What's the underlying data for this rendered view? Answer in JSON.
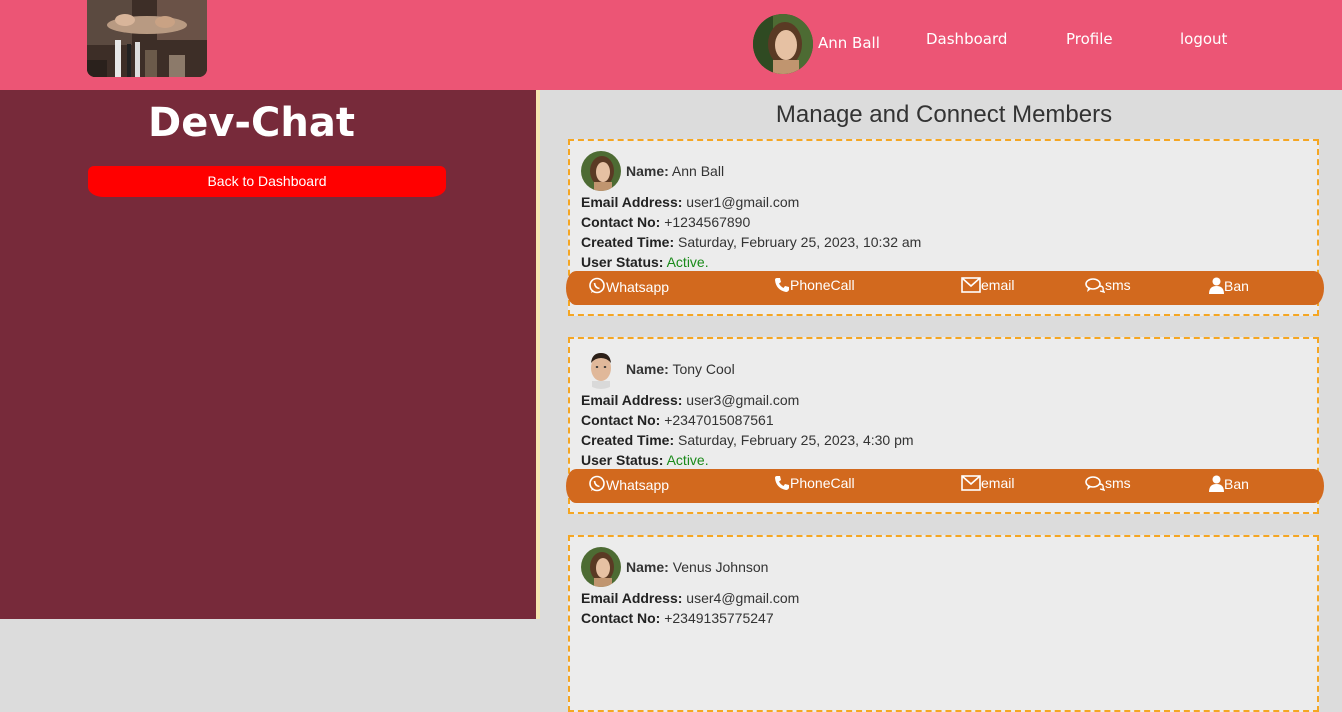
{
  "header": {
    "user_name": "Ann Ball",
    "nav": {
      "dashboard": "Dashboard",
      "profile": "Profile",
      "logout": "logout"
    }
  },
  "sidebar": {
    "brand": "Dev-Chat",
    "back_button": "Back to Dashboard"
  },
  "main": {
    "title": "Manage and Connect Members",
    "labels": {
      "name": "Name:",
      "email": "Email Address:",
      "contact": "Contact No:",
      "created": "Created Time:",
      "status": "User Status:"
    },
    "actions": {
      "whatsapp": "Whatsapp",
      "phonecall": "PhoneCall",
      "email": "email",
      "sms": "sms",
      "ban": "Ban"
    },
    "members": [
      {
        "name": "Ann Ball",
        "email": "user1@gmail.com",
        "contact": "+1234567890",
        "created": "Saturday, February 25, 2023, 10:32 am",
        "status": "Active.",
        "avatar": "woman-avatar"
      },
      {
        "name": "Tony Cool",
        "email": "user3@gmail.com",
        "contact": "+2347015087561",
        "created": "Saturday, February 25, 2023, 4:30 pm",
        "status": "Active.",
        "avatar": "man-avatar"
      },
      {
        "name": "Venus Johnson",
        "email": "user4@gmail.com",
        "contact": "+2349135775247",
        "avatar": "woman-avatar"
      }
    ]
  },
  "colors": {
    "header": "#ec5575",
    "sidebar": "#772a3a",
    "back_button": "#ff0000",
    "action_bar": "#d2691e",
    "card_border": "#f5a623",
    "status_active": "#1a8a1a"
  }
}
